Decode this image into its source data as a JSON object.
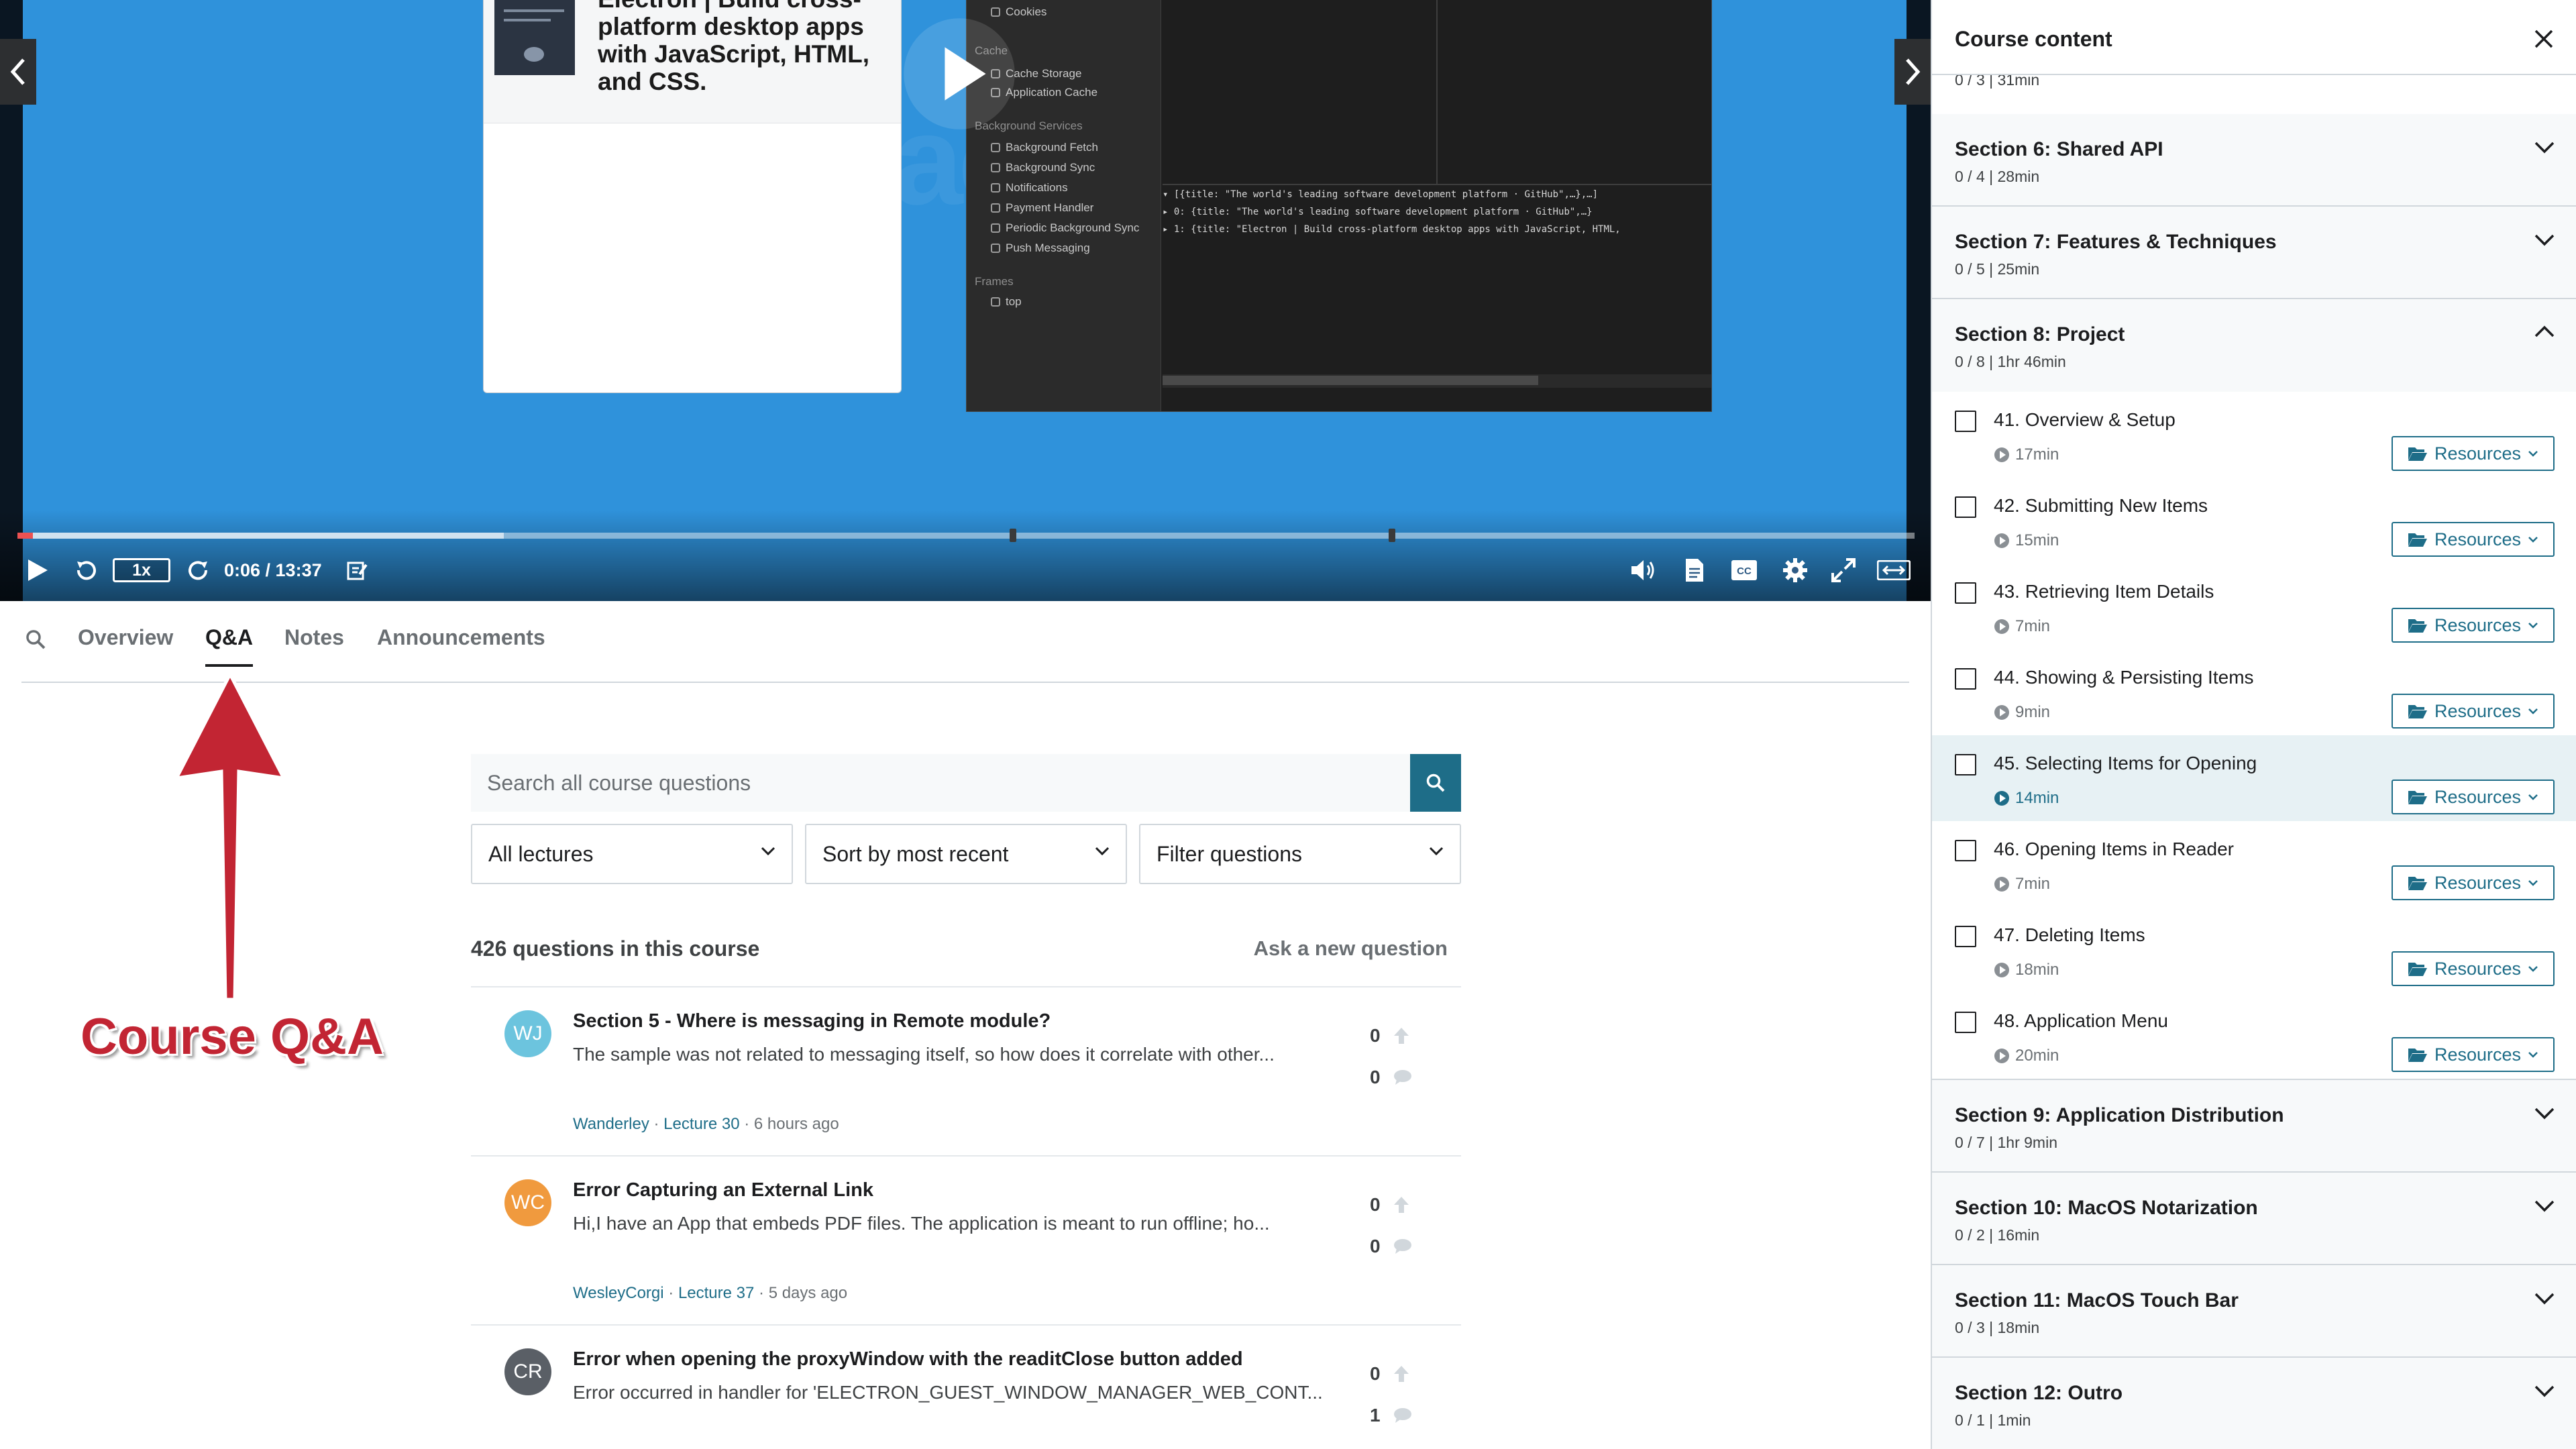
{
  "player": {
    "slide_title": "Electron | Build cross-platform desktop apps with JavaScript, HTML, and CSS.",
    "devtools": {
      "sidebar": [
        {
          "text": "Cookies",
          "type": "item"
        },
        {
          "text": "Cache",
          "type": "head"
        },
        {
          "text": "Cache Storage",
          "type": "item"
        },
        {
          "text": "Application Cache",
          "type": "item"
        },
        {
          "text": "Background Services",
          "type": "head"
        },
        {
          "text": "Background Fetch",
          "type": "item"
        },
        {
          "text": "Background Sync",
          "type": "item"
        },
        {
          "text": "Notifications",
          "type": "item"
        },
        {
          "text": "Payment Handler",
          "type": "item"
        },
        {
          "text": "Periodic Background Sync",
          "type": "item"
        },
        {
          "text": "Push Messaging",
          "type": "item"
        },
        {
          "text": "Frames",
          "type": "head"
        },
        {
          "text": "top",
          "type": "item"
        }
      ],
      "console": [
        "▾ [{title: \"The world's leading software development platform · GitHub\",…},…]",
        "  ▸ 0: {title: \"The world's leading software development platform · GitHub\",…}",
        "  ▸ 1: {title: \"Electron | Build cross-platform desktop apps with JavaScript, HTML,"
      ]
    },
    "speed": "1x",
    "time": "0:06 / 13:37",
    "progress": 0.008
  },
  "tabs": [
    "Overview",
    "Q&A",
    "Notes",
    "Announcements"
  ],
  "active_tab": "Q&A",
  "annotation": "Course Q&A",
  "qa": {
    "search_placeholder": "Search all course questions",
    "filters": [
      "All lectures",
      "Sort by most recent",
      "Filter questions"
    ],
    "count_label": "426 questions in this course",
    "ask_label": "Ask a new question",
    "questions": [
      {
        "initials": "WJ",
        "color": "#6cc4de",
        "title": "Section 5 - Where is messaging in Remote module?",
        "body": "The sample was not related to messaging itself, so how does it correlate with other...",
        "author": "Wanderley",
        "lecture": "Lecture 30",
        "time": "6 hours ago",
        "upvotes": "0",
        "replies": "0"
      },
      {
        "initials": "WC",
        "color": "#f09a3e",
        "title": "Error Capturing an External Link",
        "body": "Hi,I have an App that embeds PDF files. The application is meant to run offline; ho...",
        "author": "WesleyCorgi",
        "lecture": "Lecture 37",
        "time": "5 days ago",
        "upvotes": "0",
        "replies": "0"
      },
      {
        "initials": "CR",
        "color": "#5a5f66",
        "title": "Error when opening the proxyWindow with the readitClose button added",
        "body": "Error occurred in handler for 'ELECTRON_GUEST_WINDOW_MANAGER_WEB_CONT...",
        "author": "",
        "lecture": "",
        "time": "",
        "upvotes": "0",
        "replies": "1"
      }
    ]
  },
  "sidebar": {
    "title": "Course content",
    "partial_meta": "0 / 3 | 31min",
    "sections": [
      {
        "title": "Section 6: Shared API",
        "meta": "0 / 4 | 28min",
        "expanded": false
      },
      {
        "title": "Section 7: Features & Techniques",
        "meta": "0 / 5 | 25min",
        "expanded": false
      },
      {
        "title": "Section 8: Project",
        "meta": "0 / 8 | 1hr 46min",
        "expanded": true
      },
      {
        "title": "Section 9: Application Distribution",
        "meta": "0 / 7 | 1hr 9min",
        "expanded": false
      },
      {
        "title": "Section 10: MacOS Notarization",
        "meta": "0 / 2 | 16min",
        "expanded": false
      },
      {
        "title": "Section 11: MacOS Touch Bar",
        "meta": "0 / 3 | 18min",
        "expanded": false
      },
      {
        "title": "Section 12: Outro",
        "meta": "0 / 1 | 1min",
        "expanded": false
      }
    ],
    "lectures": [
      {
        "title": "41. Overview & Setup",
        "duration": "17min",
        "current": false
      },
      {
        "title": "42. Submitting New Items",
        "duration": "15min",
        "current": false
      },
      {
        "title": "43. Retrieving Item Details",
        "duration": "7min",
        "current": false
      },
      {
        "title": "44. Showing & Persisting Items",
        "duration": "9min",
        "current": false
      },
      {
        "title": "45. Selecting Items for Opening",
        "duration": "14min",
        "current": true
      },
      {
        "title": "46. Opening Items in Reader",
        "duration": "7min",
        "current": false
      },
      {
        "title": "47. Deleting Items",
        "duration": "18min",
        "current": false
      },
      {
        "title": "48. Application Menu",
        "duration": "20min",
        "current": false
      }
    ],
    "resources_label": "Resources"
  },
  "colors": {
    "accent": "#1e6d88",
    "progress": "#ec5252",
    "video_bg": "#2f92db",
    "annotation": "#c22533"
  }
}
